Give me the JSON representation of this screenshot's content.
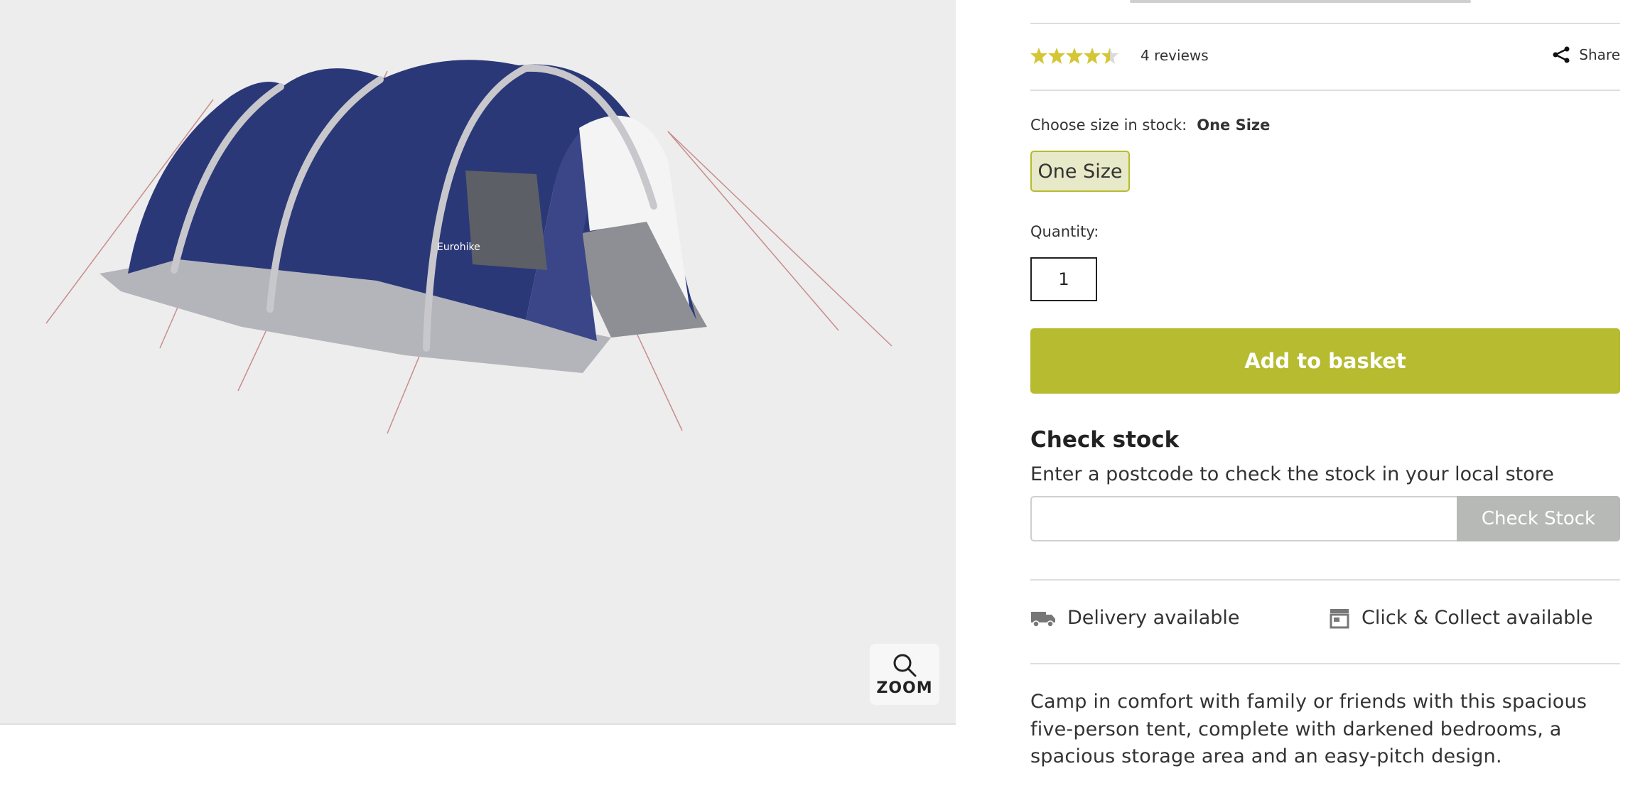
{
  "colors": {
    "accent": "#b6bb2f",
    "star": "#d4c634",
    "check_stock_button": "#b7b9b6",
    "gallery_bg": "#ededed"
  },
  "gallery": {
    "image_alt": "Eurohike tunnel tent",
    "tent_brand_text": "Eurohike",
    "zoom_label": "ZOOM",
    "zoom_icon": "search-icon"
  },
  "rating": {
    "stars": 4.5,
    "max": 5,
    "reviews_label": "4 reviews"
  },
  "share": {
    "label": "Share",
    "icon": "share-icon"
  },
  "size": {
    "label": "Choose size in stock:",
    "selected": "One Size",
    "options": [
      "One Size"
    ]
  },
  "quantity": {
    "label": "Quantity:",
    "value": "1"
  },
  "basket": {
    "label": "Add to basket"
  },
  "check_stock": {
    "title": "Check stock",
    "subtitle": "Enter a postcode to check the stock in your local store",
    "input_value": "",
    "button_label": "Check Stock"
  },
  "availability": {
    "delivery": {
      "label": "Delivery available",
      "icon": "truck-icon"
    },
    "collect": {
      "label": "Click & Collect available",
      "icon": "store-icon"
    }
  },
  "description": "Camp in comfort with family or friends with this spacious five-person tent, complete with darkened bedrooms, a spacious storage area and an easy-pitch design."
}
